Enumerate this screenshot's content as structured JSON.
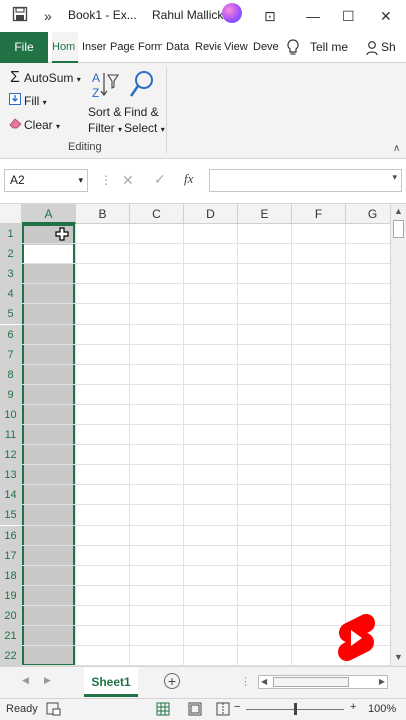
{
  "titlebar": {
    "more_glyph": "»",
    "book_title": "Book1 - Ex...",
    "user_name": "Rahul Mallick",
    "window_buttons": {
      "ribbon_display": "⊡",
      "minimize": "—",
      "restore": "☐",
      "close": "✕"
    }
  },
  "ribbon_tabs": {
    "file": "File",
    "tabs": [
      "Hom",
      "Inser",
      "Page",
      "Form",
      "Data",
      "Revie",
      "View",
      "Deve"
    ],
    "tell_me": "Tell me",
    "share": "Sh"
  },
  "editing_group": {
    "autosum": "AutoSum",
    "fill": "Fill",
    "clear": "Clear",
    "sort_line1": "Sort &",
    "sort_line2": "Filter",
    "find_line1": "Find &",
    "find_line2": "Select",
    "label": "Editing"
  },
  "formula_bar": {
    "name_box": "A2",
    "fx": "fx",
    "cancel": "✕",
    "enter": "✓",
    "value": ""
  },
  "grid": {
    "columns": [
      "A",
      "B",
      "C",
      "D",
      "E",
      "F",
      "G"
    ],
    "rows": [
      "1",
      "2",
      "3",
      "4",
      "5",
      "6",
      "7",
      "8",
      "9",
      "10",
      "11",
      "12",
      "13",
      "14",
      "15",
      "16",
      "17",
      "18",
      "19",
      "20",
      "21",
      "22"
    ],
    "selected_column": "A",
    "active_cell": "A2"
  },
  "sheets": {
    "tabs": [
      "Sheet1"
    ],
    "active": "Sheet1",
    "add": "+"
  },
  "statusbar": {
    "status": "Ready",
    "zoom_minus": "−",
    "zoom_plus": "+",
    "zoom": "100%"
  },
  "colors": {
    "excel_green": "#217346",
    "selection_gray": "#c8c8c8",
    "youtube_red": "#ff0000"
  }
}
